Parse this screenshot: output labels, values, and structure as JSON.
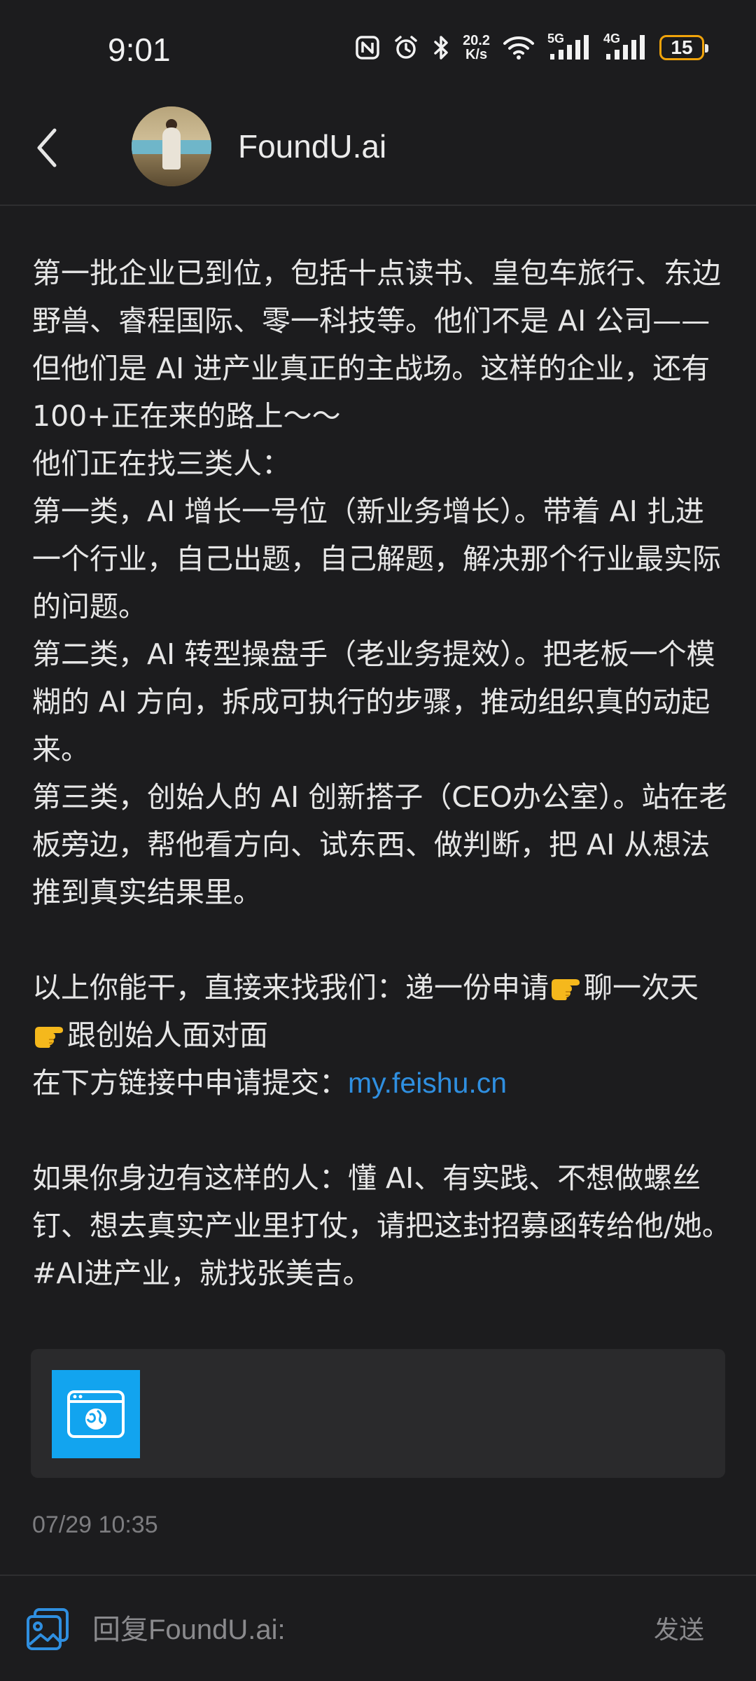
{
  "status_bar": {
    "time": "9:01",
    "net_speed_value": "20.2",
    "net_speed_unit": "K/s",
    "signal1_label": "5G",
    "signal2_label": "4G",
    "battery_level": "15",
    "battery_color": "#f0a30a"
  },
  "header": {
    "title": "FoundU.ai"
  },
  "message": {
    "paragraphs": [
      "第一批企业已到位，包括十点读书、皇包车旅行、东边野兽、睿程国际、零一科技等。他们不是 AI 公司——但他们是 AI 进产业真正的主战场。这样的企业，还有100+正在来的路上～～",
      "他们正在找三类人：",
      "第一类，AI 增长一号位（新业务增长）。带着 AI 扎进一个行业，自己出题，自己解题，解决那个行业最实际的问题。",
      "第二类，AI 转型操盘手（老业务提效）。把老板一个模糊的 AI 方向，拆成可执行的步骤，推动组织真的动起来。",
      "第三类，创始人的 AI 创新搭子（CEO办公室）。站在老板旁边，帮他看方向、试东西、做判断，把 AI 从想法推到真实结果里。"
    ],
    "cta_part1": "以上你能干，直接来找我们：递一份申请",
    "cta_part2": "聊一次天",
    "cta_part3": "跟创始人面对面",
    "apply_prefix": "在下方链接中申请提交：",
    "apply_link": "my.feishu.cn",
    "referral": "如果你身边有这样的人：懂 AI、有实践、不想做螺丝钉、想去真实产业里打仗，请把这封招募函转给他/她。",
    "hashtag": "#AI进产业，就找张美吉。",
    "link_color": "#2f8fe0"
  },
  "link_card": {
    "icon": "browser-globe-icon",
    "icon_color": "#12a4ef"
  },
  "timestamp": "07/29 10:35",
  "reply_bar": {
    "placeholder": "回复FoundU.ai:",
    "send_label": "发送"
  }
}
